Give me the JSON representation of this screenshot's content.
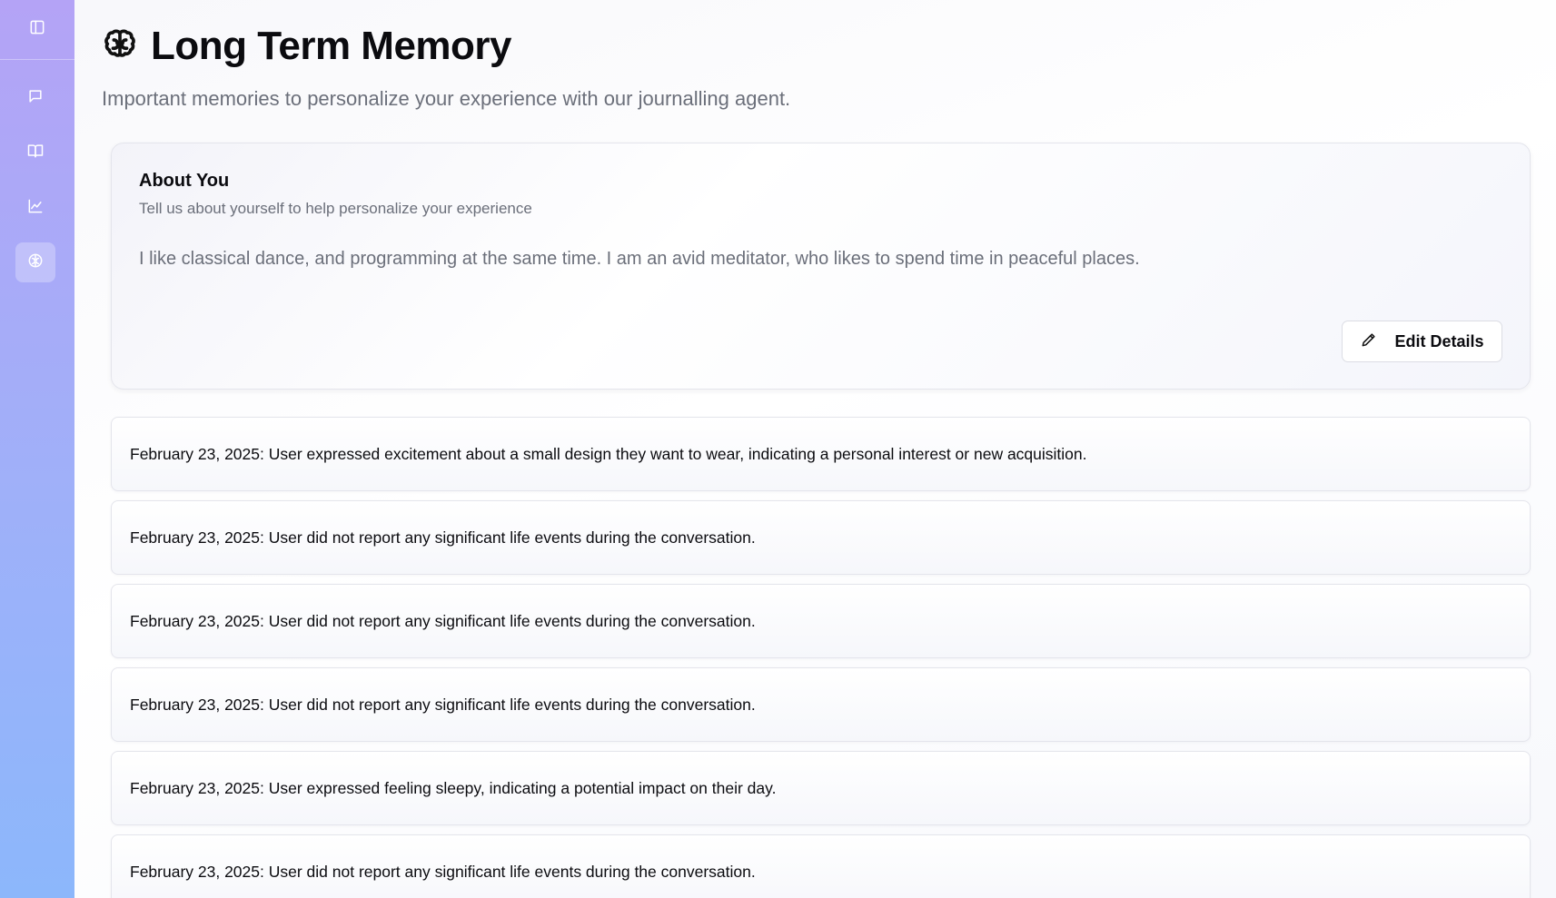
{
  "sidebar": {
    "toggle_icon": "sidebar-toggle-icon",
    "items": [
      {
        "name": "chat",
        "icon": "message-square-icon",
        "active": false
      },
      {
        "name": "journal",
        "icon": "book-open-icon",
        "active": false
      },
      {
        "name": "insights",
        "icon": "line-chart-icon",
        "active": false
      },
      {
        "name": "memory",
        "icon": "brain-icon",
        "active": true
      }
    ],
    "gradient_top": "#b4a3f6",
    "gradient_bottom": "#8cb7fb"
  },
  "header": {
    "icon": "brain-icon",
    "title": "Long Term Memory",
    "subtitle": "Important memories to personalize your experience with our journalling agent."
  },
  "about": {
    "title": "About You",
    "subtitle": "Tell us about yourself to help personalize your experience",
    "text": "I like classical dance, and programming at the same time. I am an avid meditator, who likes to spend time in peaceful places.",
    "edit_label": "Edit Details",
    "edit_icon": "pencil-icon"
  },
  "memories": [
    {
      "text": "February 23, 2025: User expressed excitement about a small design they want to wear, indicating a personal interest or new acquisition."
    },
    {
      "text": "February 23, 2025: User did not report any significant life events during the conversation."
    },
    {
      "text": "February 23, 2025: User did not report any significant life events during the conversation."
    },
    {
      "text": "February 23, 2025: User did not report any significant life events during the conversation."
    },
    {
      "text": "February 23, 2025: User expressed feeling sleepy, indicating a potential impact on their day."
    },
    {
      "text": "February 23, 2025: User did not report any significant life events during the conversation."
    }
  ]
}
